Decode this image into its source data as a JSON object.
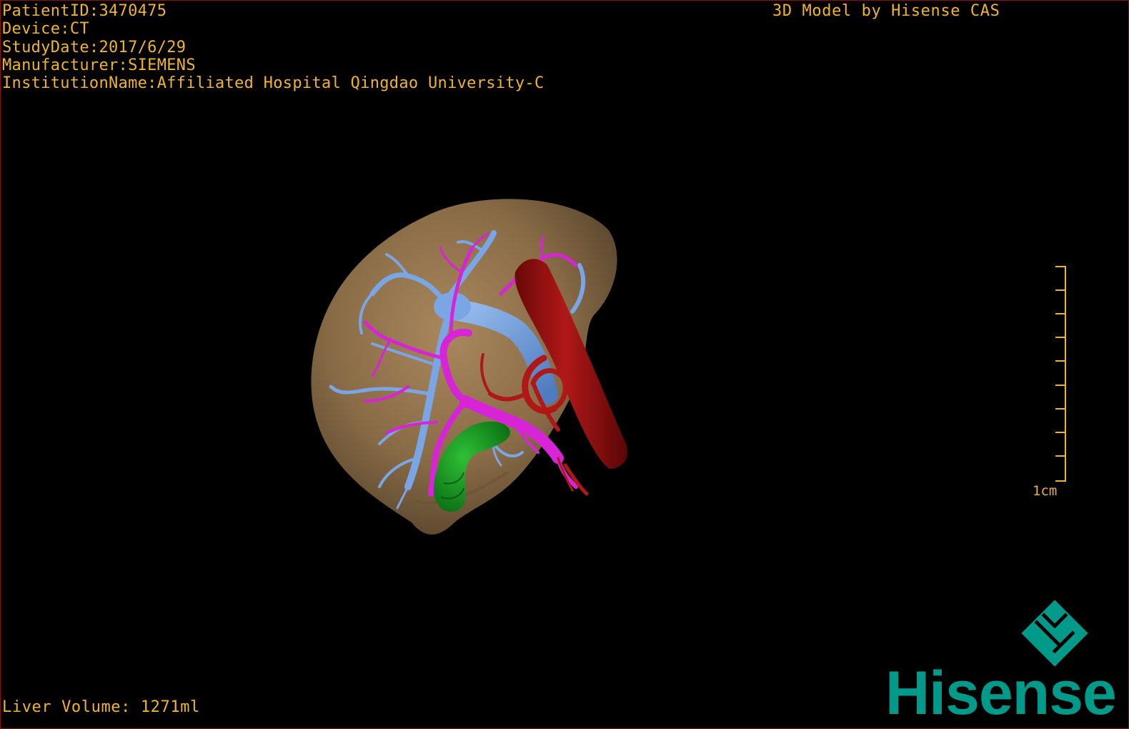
{
  "patient_info": {
    "patient_id": "PatientID:3470475",
    "device": "Device:CT",
    "study_date": "StudyDate:2017/6/29",
    "manufacturer": "Manufacturer:SIEMENS",
    "institution": "InstitutionName:Affiliated Hospital Qingdao University-C"
  },
  "model_credit": "3D Model by Hisense CAS",
  "liver_volume": "Liver Volume: 1271ml",
  "scale": {
    "label": "1cm",
    "tick_count": 10
  },
  "logo": {
    "wordmark": "Hisense",
    "icon": "hisense-cas-diamond-icon"
  },
  "colors": {
    "overlay_text": "#f0b428",
    "liver": "#9c7d55",
    "hepatic_vein": "#6f9ee0",
    "portal_vein": "#d020d0",
    "artery_ivc": "#a01010",
    "gallbladder": "#12901c",
    "brand": "#009a8a",
    "border": "#8a1010"
  },
  "structures": [
    "liver-parenchyma",
    "hepatic-veins",
    "portal-veins",
    "inferior-vena-cava",
    "hepatic-artery",
    "gallbladder"
  ]
}
